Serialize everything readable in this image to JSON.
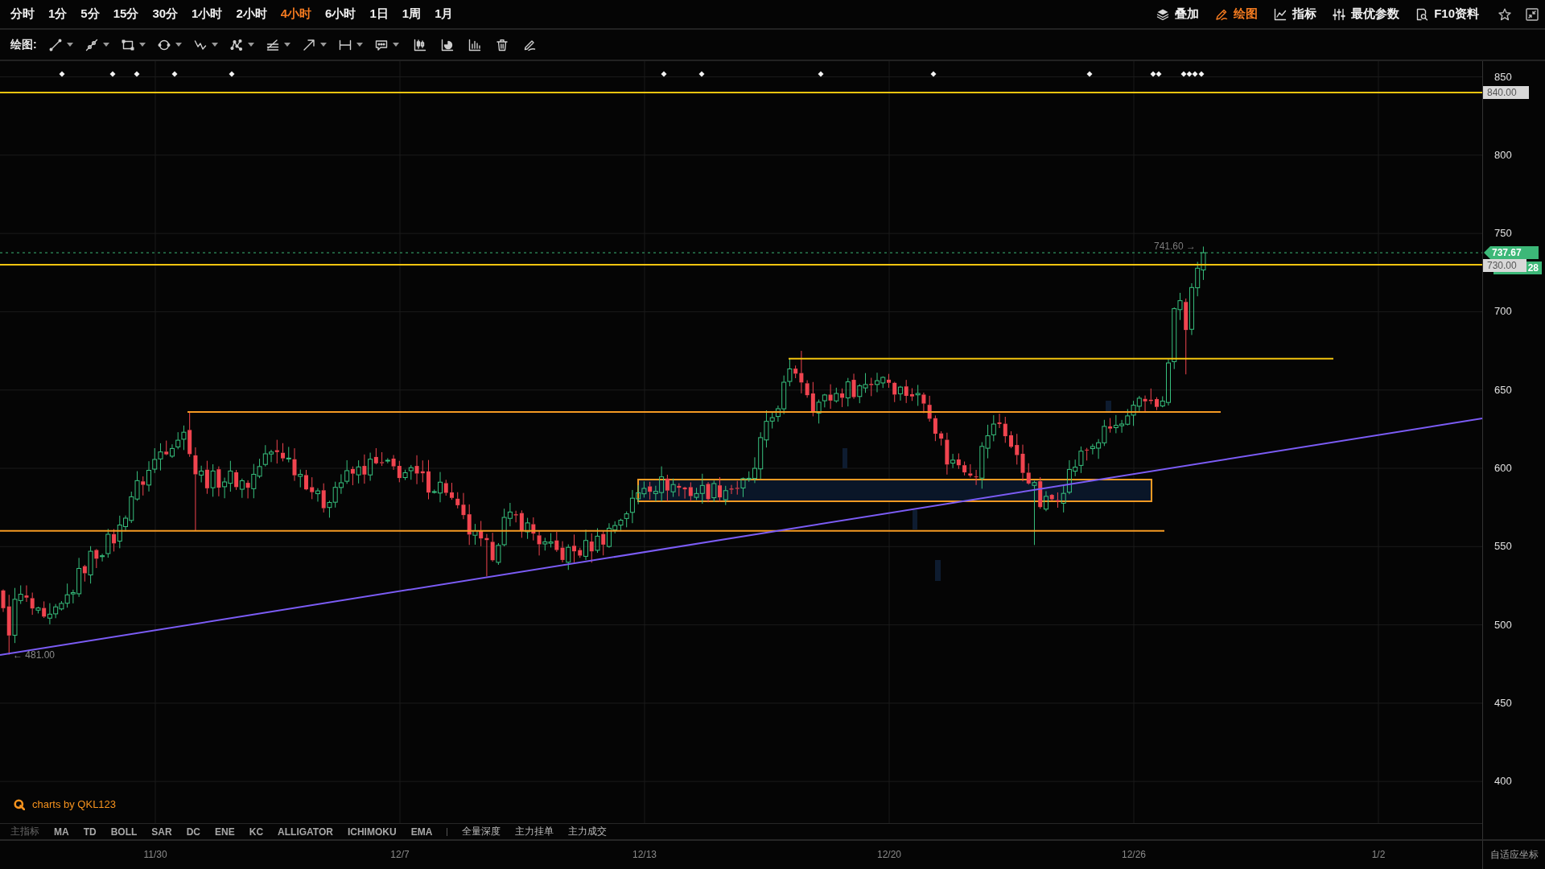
{
  "period_tabs": [
    {
      "label": "分时",
      "selected": false
    },
    {
      "label": "1分",
      "selected": false
    },
    {
      "label": "5分",
      "selected": false
    },
    {
      "label": "15分",
      "selected": false
    },
    {
      "label": "30分",
      "selected": false
    },
    {
      "label": "1小时",
      "selected": false
    },
    {
      "label": "2小时",
      "selected": false
    },
    {
      "label": "4小时",
      "selected": true
    },
    {
      "label": "6小时",
      "selected": false
    },
    {
      "label": "1日",
      "selected": false
    },
    {
      "label": "1周",
      "selected": false
    },
    {
      "label": "1月",
      "selected": false
    }
  ],
  "top_actions": [
    {
      "kind": "layers",
      "label": "叠加",
      "selected": false
    },
    {
      "kind": "draw",
      "label": "绘图",
      "selected": true
    },
    {
      "kind": "indicator",
      "label": "指标",
      "selected": false
    },
    {
      "kind": "params",
      "label": "最优参数",
      "selected": false
    },
    {
      "kind": "document",
      "label": "F10资料",
      "selected": false
    }
  ],
  "window_buttons": [
    {
      "kind": "star"
    },
    {
      "kind": "collapse"
    }
  ],
  "drawing_toolbar": {
    "label": "绘图:",
    "tools": [
      {
        "kind": "line",
        "menu": true
      },
      {
        "kind": "ray",
        "menu": true
      },
      {
        "kind": "rectangle",
        "menu": true
      },
      {
        "kind": "circle",
        "menu": true
      },
      {
        "kind": "wave",
        "menu": true
      },
      {
        "kind": "pattern",
        "menu": true
      },
      {
        "kind": "fibonacci",
        "menu": true
      },
      {
        "kind": "arrow",
        "menu": true
      },
      {
        "kind": "measure",
        "menu": true
      },
      {
        "kind": "callout",
        "menu": true
      },
      {
        "kind": "candles",
        "menu": false
      },
      {
        "kind": "pie",
        "menu": false
      },
      {
        "kind": "bars",
        "menu": false
      },
      {
        "kind": "trash",
        "menu": false
      },
      {
        "kind": "eraser",
        "menu": false
      }
    ]
  },
  "chart": {
    "price_ticks": [
      "850",
      "800",
      "750",
      "700",
      "650",
      "600",
      "550",
      "500",
      "450",
      "400"
    ],
    "upper_level_tag": "840.00",
    "last_price_tag": "737.67",
    "partial_price_tag": "28",
    "lower_level_tag": "730.00",
    "high_note": "741.60 →",
    "low_note": "← 481.00",
    "credit": "charts by QKL123"
  },
  "indicator_bar": {
    "label": "主指标",
    "items": [
      "MA",
      "TD",
      "BOLL",
      "SAR",
      "DC",
      "ENE",
      "KC",
      "ALLIGATOR",
      "ICHIMOKU",
      "EMA"
    ],
    "depth_items": [
      "全量深度",
      "主力挂单",
      "主力成交"
    ]
  },
  "date_axis": [
    "11/30",
    "12/7",
    "12/13",
    "12/20",
    "12/26",
    "1/2"
  ],
  "axis_mode": "自适应坐标"
}
